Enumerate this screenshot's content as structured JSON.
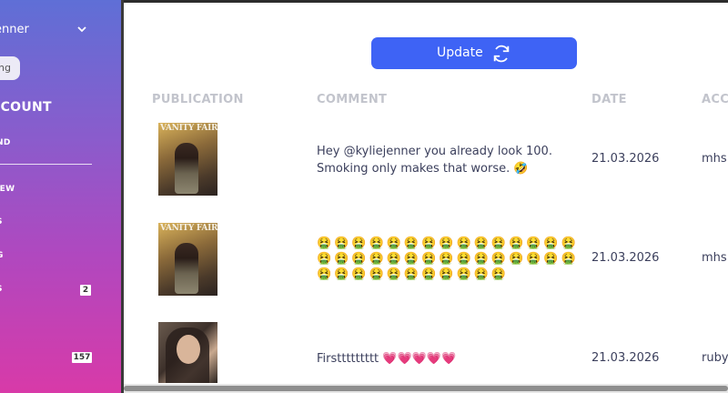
{
  "sidebar": {
    "user_name": "enner",
    "pill_label": "ng",
    "account_heading": "CCOUNT",
    "items": [
      {
        "label": "ND",
        "badge": ""
      },
      {
        "label": "IEW",
        "badge": ""
      },
      {
        "label": "S",
        "badge": ""
      },
      {
        "label": "G",
        "badge": ""
      },
      {
        "label": "S",
        "badge": "2"
      },
      {
        "label": "",
        "badge": "157"
      }
    ],
    "gradient_top": "#5f6fd6",
    "gradient_bottom": "#d83aa8"
  },
  "toolbar": {
    "update_label": "Update",
    "update_icon": "refresh-icon",
    "accent": "#3e63f5"
  },
  "table": {
    "headers": [
      "PUBLICATION",
      "COMMENT",
      "DATE",
      "ACCO"
    ],
    "rows": [
      {
        "publication": "VANITY FAIR",
        "comment_line1": "Hey @kyliejenner you already look 100.",
        "comment_line2": "Smoking only makes that worse. 🤣",
        "date": "21.03.2026",
        "account": "mhs"
      },
      {
        "publication": "VANITY FAIR",
        "comment_emojis": "🤮🤮🤮🤮🤮🤮🤮🤮🤮🤮🤮🤮🤮🤮🤮🤮🤮🤮🤮🤮🤮🤮🤮🤮🤮🤮🤮🤮🤮🤮🤮🤮🤮🤮🤮🤮🤮🤮🤮🤮🤮",
        "date": "21.03.2026",
        "account": "mhs"
      },
      {
        "publication": "",
        "comment": "Firsttttttttt 💗💗💗💗💗",
        "date": "21.03.2026",
        "account": "ruby"
      }
    ]
  }
}
